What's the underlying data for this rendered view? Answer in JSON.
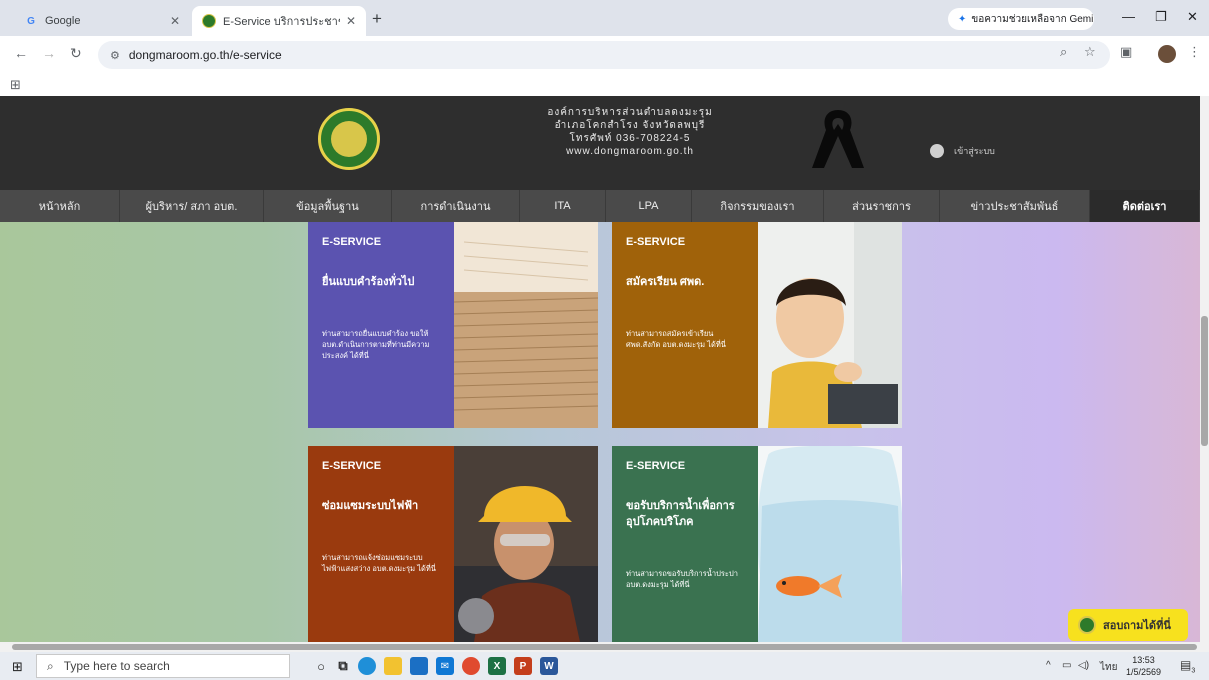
{
  "browser": {
    "tabs": [
      {
        "title": "Google",
        "favicon": "G",
        "active": false
      },
      {
        "title": "E-Service บริการประชาชน | อบต.ดองมะรุม",
        "favicon": "logo",
        "active": true
      }
    ],
    "new_tab_symbol": "+",
    "gemini_label": "ขอความช่วยเหลือจาก Gemini",
    "url": "dongmaroom.go.th/e-service"
  },
  "site": {
    "org_lines": [
      "องค์การบริหารส่วนตำบลดงมะรุม",
      "อำเภอโคกสำโรง จังหวัดลพบุรี",
      "โทรศัพท์ 036-708224-5",
      "www.dongmaroom.go.th"
    ],
    "login_label": "เข้าสู่ระบบ",
    "nav": [
      {
        "label": "หน้าหลัก",
        "active": false
      },
      {
        "label": "ผู้บริหาร/ สภา อบต.",
        "active": false
      },
      {
        "label": "ข้อมูลพื้นฐาน",
        "active": false
      },
      {
        "label": "การดำเนินงาน",
        "active": false
      },
      {
        "label": "ITA",
        "active": false
      },
      {
        "label": "LPA",
        "active": false
      },
      {
        "label": "กิจกรรมของเรา",
        "active": false
      },
      {
        "label": "ส่วนราชการ",
        "active": false
      },
      {
        "label": "ข่าวประชาสัมพันธ์",
        "active": false
      },
      {
        "label": "ติดต่อเรา",
        "active": true
      }
    ],
    "cards": [
      {
        "tag": "E-SERVICE",
        "title": "ยื่นแบบคำร้องทั่วไป",
        "description": "ท่านสามารถยื่นแบบคำร้อง ขอให้ อบต.ดำเนินการตามที่ท่านมีความประสงค์ ได้ที่นี่",
        "color": "#5b53b0"
      },
      {
        "tag": "E-SERVICE",
        "title": "สมัครเรียน ศพด.",
        "description": "ท่านสามารถสมัครเข้าเรียน ศพด.สังกัด อบต.ดงมะรุม ได้ที่นี่",
        "color": "#a0620a"
      },
      {
        "tag": "E-SERVICE",
        "title": "ซ่อมแซมระบบไฟฟ้า",
        "description": "ท่านสามารถแจ้งซ่อมแซมระบบไฟฟ้าแสงสว่าง อบต.ดงมะรุม ได้ที่นี่",
        "color": "#9a3a0e"
      },
      {
        "tag": "E-SERVICE",
        "title": "ขอรับบริการน้ำเพื่อการอุปโภคบริโภค",
        "description": "ท่านสามารถขอรับบริการน้ำประปา อบต.ดงมะรุม ได้ที่นี่",
        "color": "#3a7250"
      }
    ],
    "chat_label": "สอบถามได้ที่นี่"
  },
  "taskbar": {
    "search_placeholder": "Type here to search",
    "lang": "ไทย",
    "time": "13:53",
    "date": "1/5/2569",
    "notifications": "3"
  }
}
